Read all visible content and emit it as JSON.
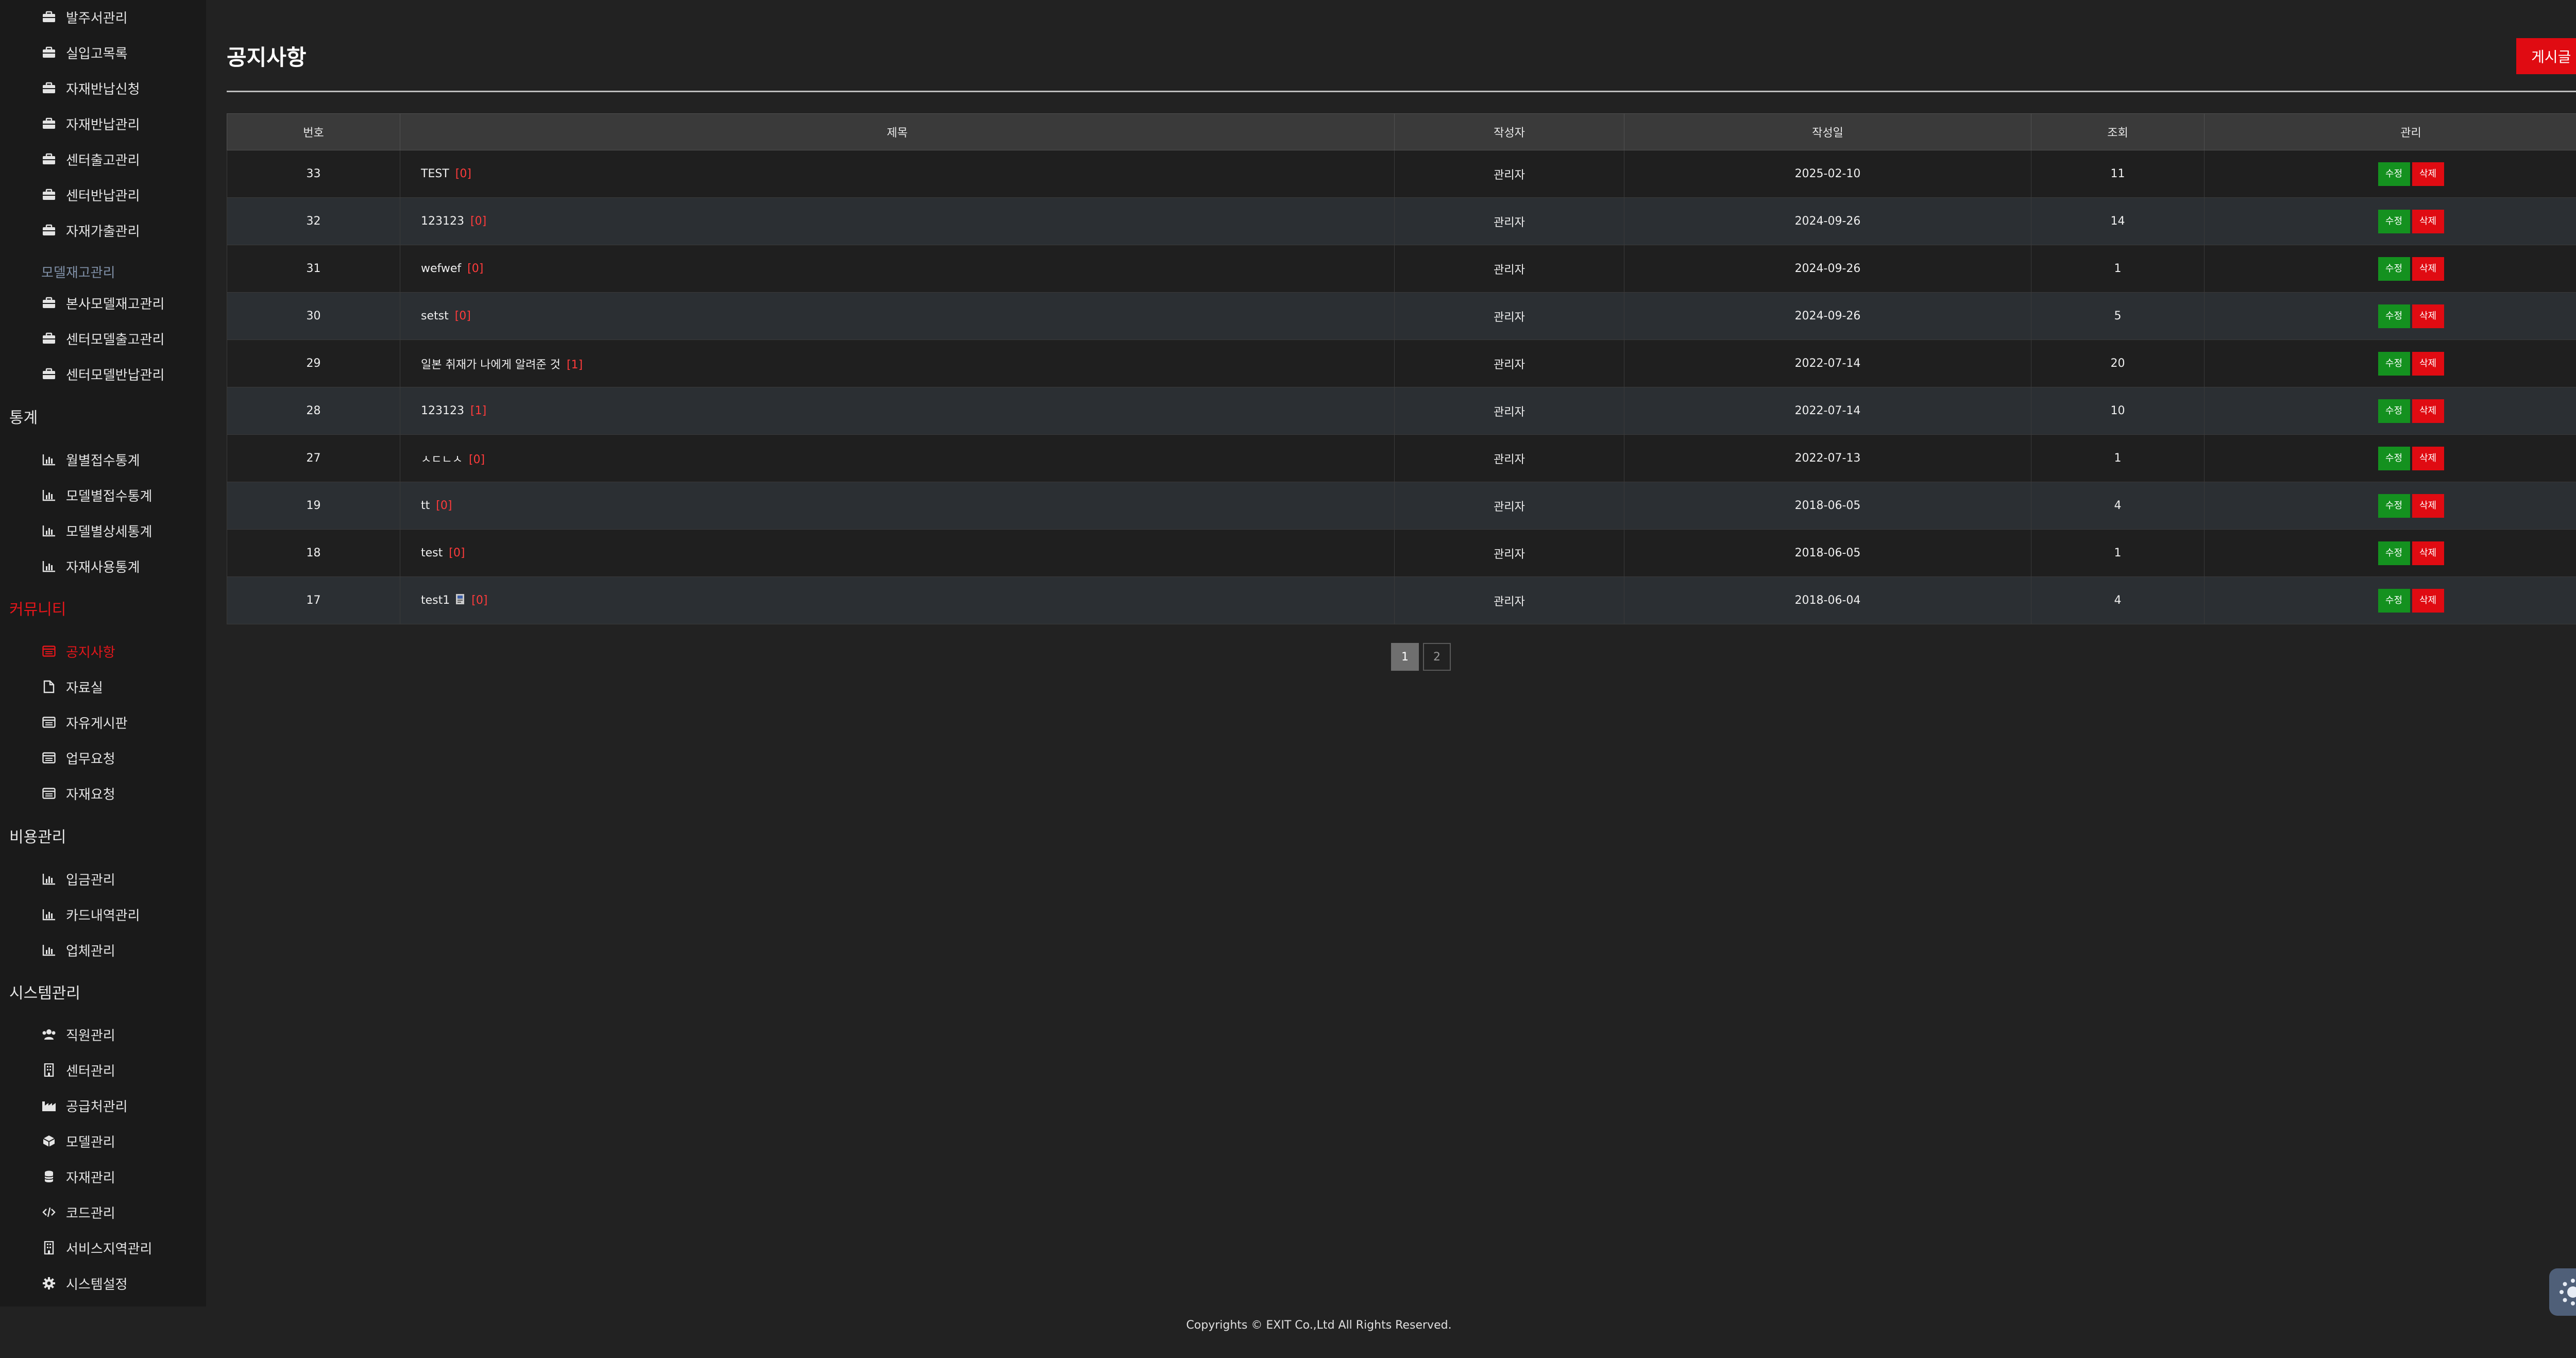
{
  "sidebar": {
    "inventory_items": [
      {
        "label": "발주서관리",
        "icon": "briefcase-icon"
      },
      {
        "label": "실입고목록",
        "icon": "briefcase-icon"
      },
      {
        "label": "자재반납신청",
        "icon": "briefcase-icon"
      },
      {
        "label": "자재반납관리",
        "icon": "briefcase-icon"
      },
      {
        "label": "센터출고관리",
        "icon": "briefcase-icon"
      },
      {
        "label": "센터반납관리",
        "icon": "briefcase-icon"
      },
      {
        "label": "자재가출관리",
        "icon": "briefcase-icon"
      }
    ],
    "model_group_label": "모델재고관리",
    "model_items": [
      {
        "label": "본사모델재고관리",
        "icon": "briefcase-icon"
      },
      {
        "label": "센터모델출고관리",
        "icon": "briefcase-icon"
      },
      {
        "label": "센터모델반납관리",
        "icon": "briefcase-icon"
      }
    ],
    "stats_label": "통계",
    "stats_items": [
      {
        "label": "월별접수통계",
        "icon": "bar-chart-icon"
      },
      {
        "label": "모델별접수통계",
        "icon": "bar-chart-icon"
      },
      {
        "label": "모델별상세통계",
        "icon": "bar-chart-icon"
      },
      {
        "label": "자재사용통계",
        "icon": "bar-chart-icon"
      }
    ],
    "community_label": "커뮤니티",
    "community_items": [
      {
        "label": "공지사항",
        "icon": "board-icon",
        "active": true
      },
      {
        "label": "자료실",
        "icon": "file-icon"
      },
      {
        "label": "자유게시판",
        "icon": "board-icon"
      },
      {
        "label": "업무요청",
        "icon": "board-icon"
      },
      {
        "label": "자재요청",
        "icon": "board-icon"
      }
    ],
    "cost_label": "비용관리",
    "cost_items": [
      {
        "label": "입금관리",
        "icon": "bar-chart-icon"
      },
      {
        "label": "카드내역관리",
        "icon": "bar-chart-icon"
      },
      {
        "label": "업체관리",
        "icon": "bar-chart-icon"
      }
    ],
    "system_label": "시스템관리",
    "system_items": [
      {
        "label": "직원관리",
        "icon": "users-icon"
      },
      {
        "label": "센터관리",
        "icon": "building-icon"
      },
      {
        "label": "공급처관리",
        "icon": "factory-icon"
      },
      {
        "label": "모델관리",
        "icon": "cube-icon"
      },
      {
        "label": "자재관리",
        "icon": "database-icon"
      },
      {
        "label": "코드관리",
        "icon": "code-icon"
      },
      {
        "label": "서비스지역관리",
        "icon": "building-icon"
      },
      {
        "label": "시스템설정",
        "icon": "gear-icon"
      }
    ]
  },
  "main": {
    "title": "공지사항",
    "write_button": "게시글 작성",
    "table": {
      "headers": [
        "번호",
        "제목",
        "작성자",
        "작성일",
        "조회",
        "관리"
      ],
      "rows": [
        {
          "no": "33",
          "title": "TEST",
          "comments": "[0]",
          "author": "관리자",
          "date": "2025-02-10",
          "views": "11",
          "attach": false
        },
        {
          "no": "32",
          "title": "123123",
          "comments": "[0]",
          "author": "관리자",
          "date": "2024-09-26",
          "views": "14",
          "attach": false
        },
        {
          "no": "31",
          "title": "wefwef",
          "comments": "[0]",
          "author": "관리자",
          "date": "2024-09-26",
          "views": "1",
          "attach": false
        },
        {
          "no": "30",
          "title": "setst",
          "comments": "[0]",
          "author": "관리자",
          "date": "2024-09-26",
          "views": "5",
          "attach": false
        },
        {
          "no": "29",
          "title": "일본 취재가 나에게 알려준 것",
          "comments": "[1]",
          "author": "관리자",
          "date": "2022-07-14",
          "views": "20",
          "attach": false
        },
        {
          "no": "28",
          "title": "123123",
          "comments": "[1]",
          "author": "관리자",
          "date": "2022-07-14",
          "views": "10",
          "attach": false
        },
        {
          "no": "27",
          "title": "ㅅㄷㄴㅅ",
          "comments": "[0]",
          "author": "관리자",
          "date": "2022-07-13",
          "views": "1",
          "attach": false
        },
        {
          "no": "19",
          "title": "tt",
          "comments": "[0]",
          "author": "관리자",
          "date": "2018-06-05",
          "views": "4",
          "attach": false
        },
        {
          "no": "18",
          "title": "test",
          "comments": "[0]",
          "author": "관리자",
          "date": "2018-06-05",
          "views": "1",
          "attach": false
        },
        {
          "no": "17",
          "title": "test1",
          "comments": "[0]",
          "author": "관리자",
          "date": "2018-06-04",
          "views": "4",
          "attach": true
        }
      ],
      "edit_label": "수정",
      "delete_label": "삭제"
    },
    "pagination": {
      "pages": [
        "1",
        "2"
      ],
      "current": "1"
    }
  },
  "footer": {
    "text": "Copyrights © EXIT Co.,Ltd All Rights Reserved."
  },
  "theme_toggle": {
    "icon": "sun-icon"
  },
  "colors": {
    "accent": "#e00b12",
    "edit": "#14911f",
    "background": "#222222",
    "sidebar": "#1a1a1a"
  }
}
